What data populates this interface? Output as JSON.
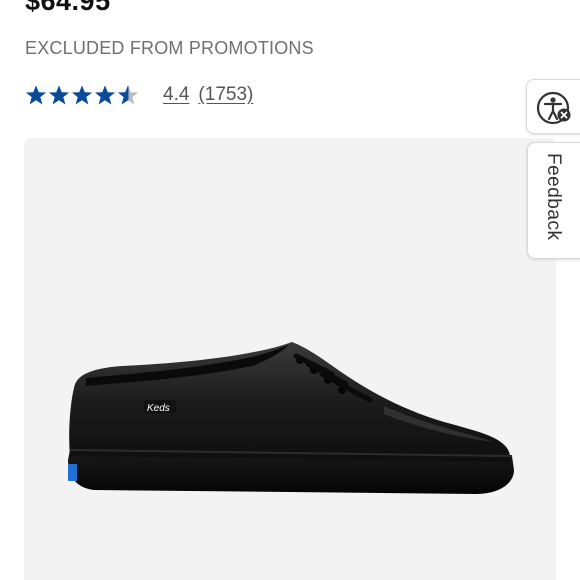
{
  "product": {
    "price": "$64.95",
    "promo_note": "EXCLUDED FROM PROMOTIONS",
    "rating": {
      "value": "4.4",
      "count": "(1753)",
      "stars_filled_fraction": 0.88
    },
    "image": {
      "brand_logo_text": "Keds",
      "alt": "black leather lace-up sneaker"
    }
  },
  "side_widgets": {
    "accessibility_icon": "accessibility-person-icon",
    "feedback_label": "Feedback"
  },
  "colors": {
    "star": "#0a4a9b",
    "star_empty": "#bdbdbd",
    "muted_text": "#707070",
    "image_bg": "#f3f3f3",
    "logo_blue": "#1e6fd6"
  }
}
